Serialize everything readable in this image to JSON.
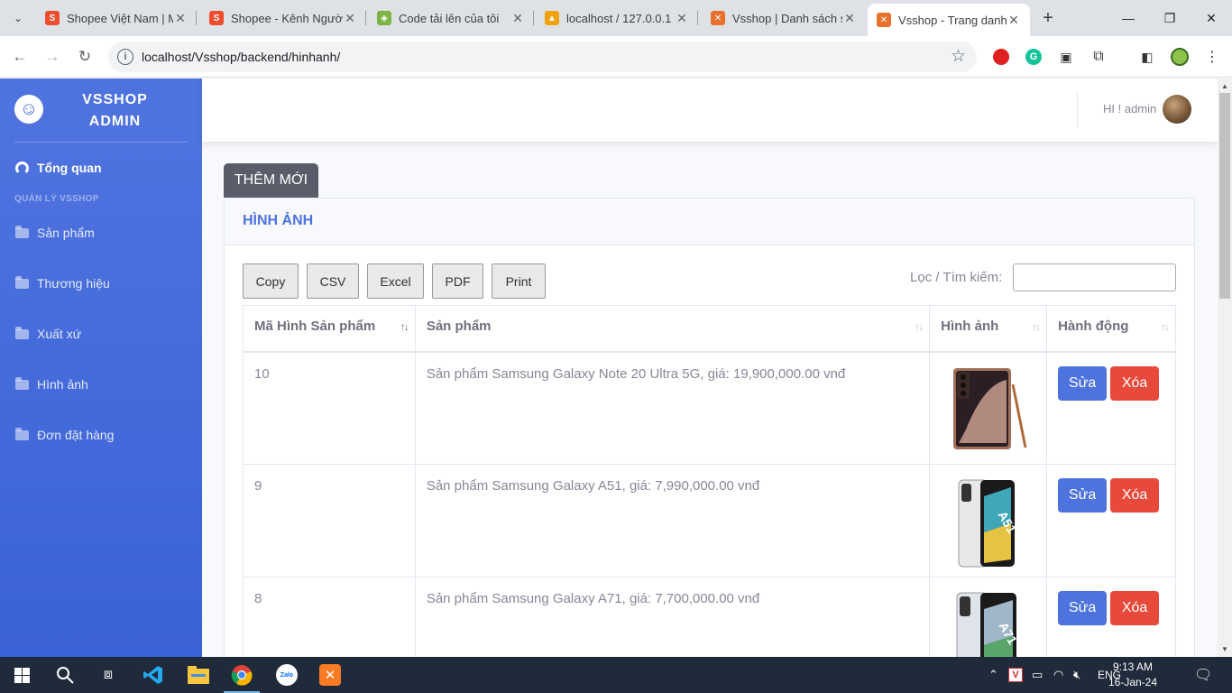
{
  "browser": {
    "tabs": [
      {
        "title": "Shopee Việt Nam | M",
        "favicon_color": "#ee4d2d",
        "favicon_glyph": "S"
      },
      {
        "title": "Shopee - Kênh Người",
        "favicon_color": "#ee4d2d",
        "favicon_glyph": "S"
      },
      {
        "title": "Code tải lên của tôi",
        "favicon_color": "#7cb342",
        "favicon_glyph": "◈"
      },
      {
        "title": "localhost / 127.0.0.1 /",
        "favicon_color": "#f0a30a",
        "favicon_glyph": "▲"
      },
      {
        "title": "Vsshop | Danh sách s",
        "favicon_color": "#e8712b",
        "favicon_glyph": "✕"
      },
      {
        "title": "Vsshop - Trang danh",
        "favicon_color": "#e8712b",
        "favicon_glyph": "✕"
      }
    ],
    "url": "localhost/Vsshop/backend/hinhanh/"
  },
  "sidebar": {
    "brand": "VSSHOP ADMIN",
    "dashboard_label": "Tổng quan",
    "section_heading": "QUẢN LÝ VSSHOP",
    "items": [
      {
        "label": "Sản phẩm"
      },
      {
        "label": "Thương hiệu"
      },
      {
        "label": "Xuất xứ"
      },
      {
        "label": "Hình ảnh"
      },
      {
        "label": "Đơn đặt hàng"
      }
    ]
  },
  "topbar": {
    "greeting": "HI ! admin"
  },
  "main": {
    "add_button": "THÊM MỚI",
    "card_title": "HÌNH ẢNH",
    "export_buttons": [
      "Copy",
      "CSV",
      "Excel",
      "PDF",
      "Print"
    ],
    "filter_label": "Lọc / Tìm kiếm:",
    "filter_value": "",
    "columns": [
      "Mã Hình Sản phẩm",
      "Sản phẩm",
      "Hình ảnh",
      "Hành động"
    ],
    "rows": [
      {
        "id": "10",
        "product": "Sản phẩm Samsung Galaxy Note 20 Ultra 5G, giá: 19,900,000.00 vnđ",
        "image": "Note 20 Ultra",
        "edit": "Sửa",
        "delete": "Xóa"
      },
      {
        "id": "9",
        "product": "Sản phẩm Samsung Galaxy A51, giá: 7,990,000.00 vnđ",
        "image": "A51",
        "edit": "Sửa",
        "delete": "Xóa"
      },
      {
        "id": "8",
        "product": "Sản phẩm Samsung Galaxy A71, giá: 7,700,000.00 vnđ",
        "image": "A71",
        "edit": "Sửa",
        "delete": "Xóa"
      }
    ]
  },
  "taskbar": {
    "language": "ENG",
    "time": "9:13 AM",
    "date": "16-Jan-24"
  },
  "colors": {
    "sidebar": "#4e73df",
    "primary": "#4e73df",
    "danger": "#e74a3b",
    "add_button": "#5a5c69"
  }
}
